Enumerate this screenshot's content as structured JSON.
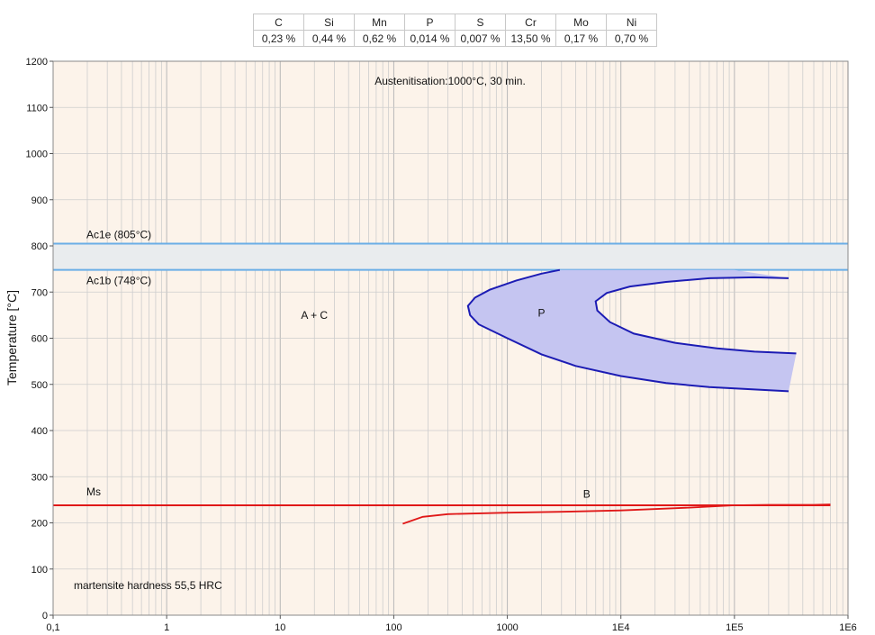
{
  "composition": {
    "elements": [
      "C",
      "Si",
      "Mn",
      "P",
      "S",
      "Cr",
      "Mo",
      "Ni"
    ],
    "values": [
      "0,23 %",
      "0,44 %",
      "0,62 %",
      "0,014 %",
      "0,007 %",
      "13,50 %",
      "0,17 %",
      "0,70 %"
    ]
  },
  "chart_data": {
    "type": "line",
    "title": "Austenitisation:1000°C, 30 min.",
    "ylabel": "Temperature [°C]",
    "xlabel": "",
    "x_scale": "log",
    "xlim": [
      0.1,
      1000000
    ],
    "ylim": [
      0,
      1200
    ],
    "grid": true,
    "x_tick_values": [
      0.1,
      1,
      10,
      100,
      1000,
      10000,
      100000,
      1000000
    ],
    "x_tick_labels": [
      "0,1",
      "1",
      "10",
      "100",
      "1000",
      "1E4",
      "1E5",
      "1E6"
    ],
    "y_ticks": [
      0,
      100,
      200,
      300,
      400,
      500,
      600,
      700,
      800,
      900,
      1000,
      1100,
      1200
    ],
    "colors": {
      "background": "#fcf3ea",
      "grid": "#cdcdcd",
      "ac_band": "#e9ecee",
      "ac_line": "#6aaee6",
      "pearlite_fill": "#c5c5f1",
      "pearlite_line": "#1c1cb4",
      "bainite_line": "#e01818"
    },
    "ac_lines": [
      {
        "label": "Ac1e (805°C)",
        "value": 805
      },
      {
        "label": "Ac1b (748°C)",
        "value": 748
      }
    ],
    "ms": {
      "label": "Ms",
      "value": 238
    },
    "regions": [
      {
        "label": "A + C",
        "x": 20,
        "y": 650
      },
      {
        "label": "P",
        "x": 2000,
        "y": 655
      },
      {
        "label": "B",
        "x": 5000,
        "y": 262
      }
    ],
    "annotation": "martensite hardness  55,5 HRC",
    "pearlite_start": [
      [
        2900,
        748
      ],
      [
        2000,
        740
      ],
      [
        1200,
        725
      ],
      [
        700,
        705
      ],
      [
        520,
        688
      ],
      [
        450,
        670
      ],
      [
        470,
        650
      ],
      [
        560,
        630
      ],
      [
        1000,
        600
      ],
      [
        2000,
        565
      ],
      [
        4000,
        540
      ],
      [
        10000,
        518
      ],
      [
        25000,
        503
      ],
      [
        60000,
        494
      ],
      [
        300000,
        485
      ]
    ],
    "pearlite_finish": [
      [
        300000,
        730
      ],
      [
        150000,
        732
      ],
      [
        60000,
        730
      ],
      [
        25000,
        722
      ],
      [
        12000,
        712
      ],
      [
        7500,
        698
      ],
      [
        6000,
        680
      ],
      [
        6200,
        660
      ],
      [
        8000,
        635
      ],
      [
        13000,
        610
      ],
      [
        30000,
        590
      ],
      [
        70000,
        578
      ],
      [
        150000,
        571
      ],
      [
        350000,
        567
      ]
    ],
    "bainite_start": [
      [
        120,
        198
      ],
      [
        180,
        213
      ],
      [
        300,
        219
      ],
      [
        1000,
        222
      ],
      [
        3000,
        224
      ],
      [
        10000,
        227
      ],
      [
        40000,
        233
      ],
      [
        100000,
        238
      ],
      [
        200000,
        239
      ],
      [
        500000,
        239
      ],
      [
        700000,
        240
      ]
    ]
  }
}
